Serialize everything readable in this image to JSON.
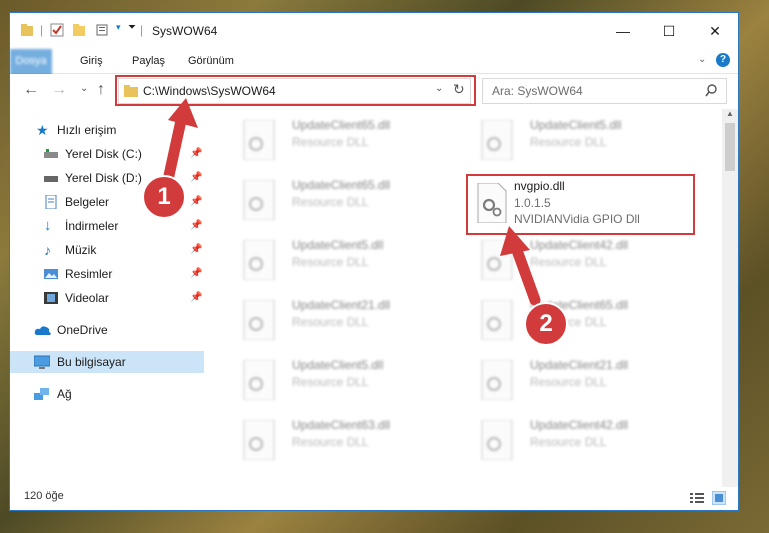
{
  "window": {
    "title": "SysWOW64",
    "controls": {
      "minimize": "—",
      "maximize": "☐",
      "close": "✕"
    }
  },
  "ribbon": {
    "tabs": [
      {
        "label": "Dosya"
      },
      {
        "label": "Giriş"
      },
      {
        "label": "Paylaş"
      },
      {
        "label": "Görünüm"
      }
    ],
    "help": "?"
  },
  "navbar": {
    "address": "C:\\Windows\\SysWOW64",
    "search_placeholder": "Ara: SysWOW64"
  },
  "sidebar": {
    "items": [
      {
        "label": "Hızlı erişim",
        "icon": "star-icon"
      },
      {
        "label": "Yerel Disk (C:)",
        "icon": "drive-icon",
        "pinned": true
      },
      {
        "label": "Yerel Disk (D:)",
        "icon": "drive-icon",
        "pinned": true
      },
      {
        "label": "Belgeler",
        "icon": "document-icon",
        "pinned": true
      },
      {
        "label": "İndirmeler",
        "icon": "download-icon",
        "pinned": true
      },
      {
        "label": "Müzik",
        "icon": "music-icon",
        "pinned": true
      },
      {
        "label": "Resimler",
        "icon": "pictures-icon",
        "pinned": true
      },
      {
        "label": "Videolar",
        "icon": "video-icon",
        "pinned": true
      },
      {
        "label": "OneDrive",
        "icon": "cloud-icon"
      },
      {
        "label": "Bu bilgisayar",
        "icon": "computer-icon",
        "selected": true
      },
      {
        "label": "Ağ",
        "icon": "network-icon"
      }
    ]
  },
  "files": {
    "left": [
      {
        "name": "UpdateClient65.dll",
        "type": "Resource DLL"
      },
      {
        "name": "UpdateClient65.dll",
        "type": "Resource DLL"
      },
      {
        "name": "UpdateClient5.dll",
        "type": "Resource DLL"
      },
      {
        "name": "UpdateClient21.dll",
        "type": "Resource DLL"
      },
      {
        "name": "UpdateClient5.dll",
        "type": "Resource DLL"
      },
      {
        "name": "UpdateClient63.dll",
        "type": "Resource DLL"
      }
    ],
    "right": [
      {
        "name": "UpdateClient5.dll",
        "type": "Resource DLL"
      },
      {
        "name": "UpdateClient42.dll",
        "type": "Resource DLL"
      },
      {
        "name": "UpdateClient65.dll",
        "type": "Resource DLL"
      },
      {
        "name": "UpdateClient21.dll",
        "type": "Resource DLL"
      },
      {
        "name": "UpdateClient42.dll",
        "type": "Resource DLL"
      }
    ],
    "highlighted": {
      "name": "nvgpio.dll",
      "version": "1.0.1.5",
      "description": "NVIDIANVidia GPIO Dll"
    }
  },
  "status": {
    "count": "120 öğe"
  },
  "annotations": {
    "step1": "1",
    "step2": "2",
    "color": "#d23b3b"
  }
}
